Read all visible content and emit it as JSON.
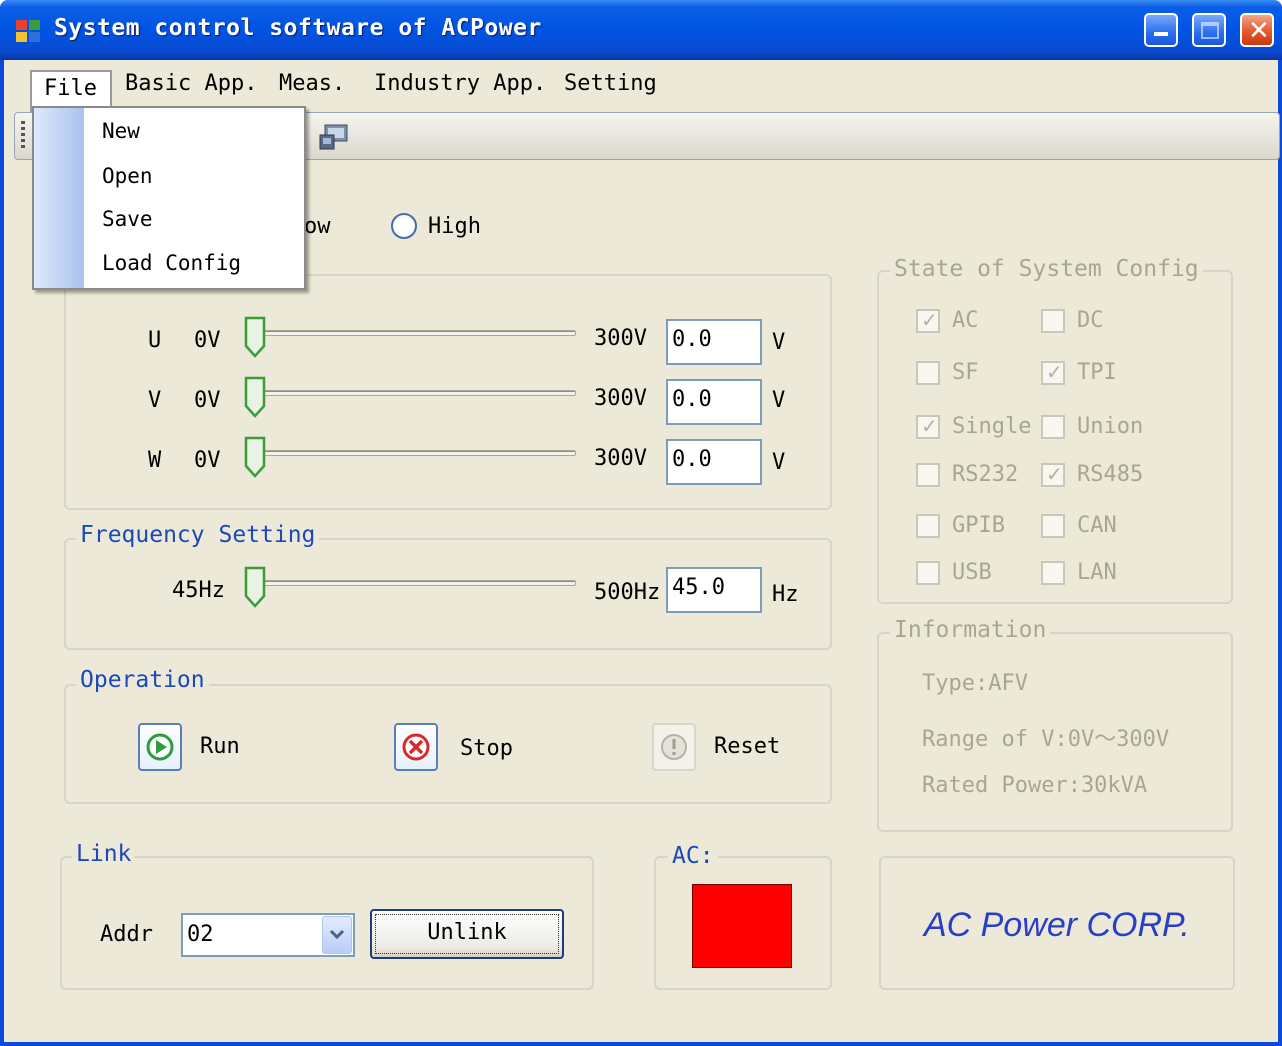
{
  "window": {
    "title": "System control software of ACPower"
  },
  "menu": {
    "items": [
      "File",
      "Basic App.",
      "Meas.",
      "Industry App.",
      "Setting"
    ],
    "file_dropdown": [
      "New",
      "Open",
      "Save",
      "Load Config"
    ]
  },
  "range": {
    "partial_low": "ow",
    "high_label": "High"
  },
  "voltage": {
    "rows": [
      {
        "phase": "U",
        "min": "0V",
        "max": "300V",
        "value": "0.0",
        "unit": "V"
      },
      {
        "phase": "V",
        "min": "0V",
        "max": "300V",
        "value": "0.0",
        "unit": "V"
      },
      {
        "phase": "W",
        "min": "0V",
        "max": "300V",
        "value": "0.0",
        "unit": "V"
      }
    ]
  },
  "frequency": {
    "title": "Frequency Setting",
    "min": "45Hz",
    "max": "500Hz",
    "value": "45.0",
    "unit": "Hz"
  },
  "operation": {
    "title": "Operation",
    "run": "Run",
    "stop": "Stop",
    "reset": "Reset"
  },
  "state": {
    "title": "State of System Config",
    "checks": [
      {
        "label": "AC",
        "checked": true
      },
      {
        "label": "DC",
        "checked": false
      },
      {
        "label": "SF",
        "checked": false
      },
      {
        "label": "TPI",
        "checked": true
      },
      {
        "label": "Single",
        "checked": true
      },
      {
        "label": "Union",
        "checked": false
      },
      {
        "label": "RS232",
        "checked": false
      },
      {
        "label": "RS485",
        "checked": true
      },
      {
        "label": "GPIB",
        "checked": false
      },
      {
        "label": "CAN",
        "checked": false
      },
      {
        "label": "USB",
        "checked": false
      },
      {
        "label": "LAN",
        "checked": false
      }
    ]
  },
  "information": {
    "title": "Information",
    "type": "Type:AFV",
    "range": "Range of V:0V～300V",
    "power": "Rated Power:30kVA"
  },
  "link": {
    "title": "Link",
    "addr_label": "Addr",
    "addr_value": "02",
    "unlink_label": "Unlink"
  },
  "ac": {
    "title": "AC:",
    "indicator_color": "#ff0000"
  },
  "brand": {
    "text": "AC Power CORP."
  },
  "colors": {
    "title_bar": "#0054e3",
    "group_title": "#1c49b8",
    "window_bg": "#ece9d8"
  }
}
